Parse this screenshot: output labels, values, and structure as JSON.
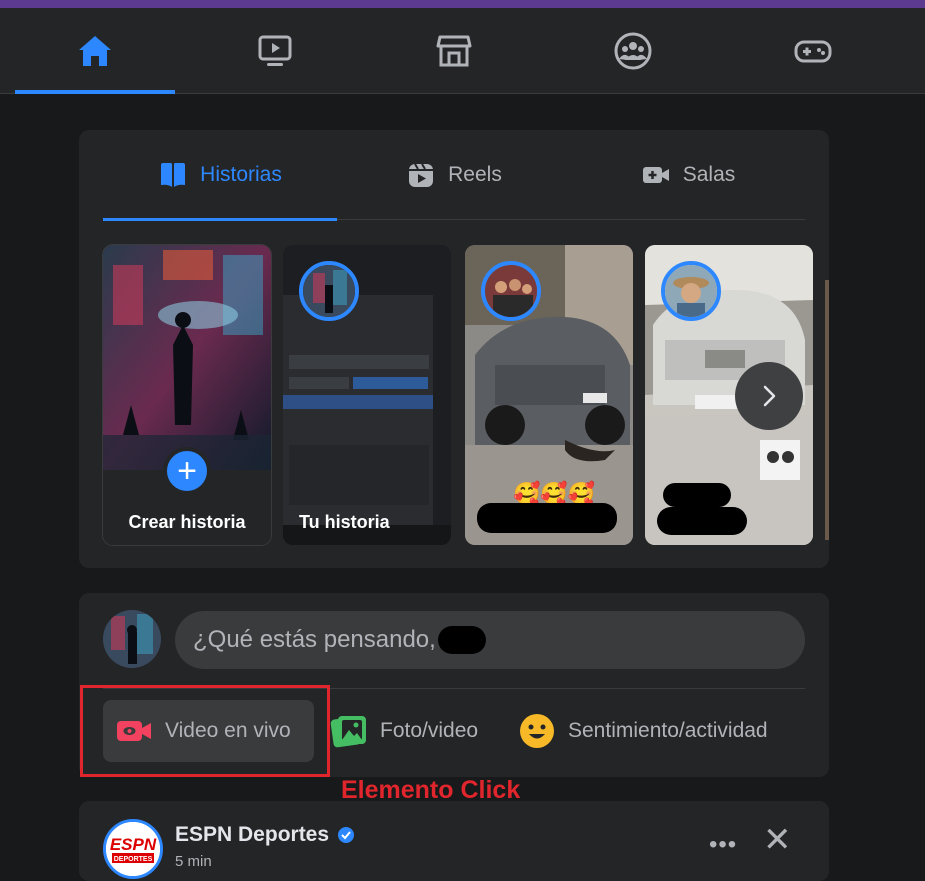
{
  "topnav": {
    "items": [
      {
        "name": "home-icon",
        "active": true
      },
      {
        "name": "watch-icon",
        "active": false
      },
      {
        "name": "marketplace-icon",
        "active": false
      },
      {
        "name": "groups-icon",
        "active": false
      },
      {
        "name": "gaming-icon",
        "active": false
      }
    ],
    "accent": "#2d88ff",
    "strip_color": "#5b3a8f"
  },
  "stories_card": {
    "tabs": [
      {
        "label": "Historias",
        "icon": "book-icon",
        "active": true
      },
      {
        "label": "Reels",
        "icon": "reels-icon",
        "active": false
      },
      {
        "label": "Salas",
        "icon": "video-camera-icon",
        "active": false
      }
    ],
    "stories": [
      {
        "label": "Crear historia"
      },
      {
        "label": "Tu historia"
      },
      {
        "label": ""
      },
      {
        "label": ""
      }
    ],
    "emojis": "🥰🥰🥰"
  },
  "composer": {
    "placeholder": "¿Qué estás pensando,",
    "actions": [
      {
        "label": "Video en vivo",
        "icon": "live-video-icon",
        "color": "#f3425f"
      },
      {
        "label": "Foto/video",
        "icon": "photo-icon",
        "color": "#45bd62"
      },
      {
        "label": "Sentimiento/actividad",
        "icon": "feeling-icon",
        "color": "#f7b928"
      }
    ]
  },
  "annotation": {
    "label": "Elemento Click",
    "color": "#e0262c"
  },
  "post": {
    "author": "ESPN Deportes",
    "verified": true,
    "subtitle": "5 min",
    "more_label": "•••",
    "close_label": "✕",
    "avatar_text": "ESPN DEPORTES"
  }
}
